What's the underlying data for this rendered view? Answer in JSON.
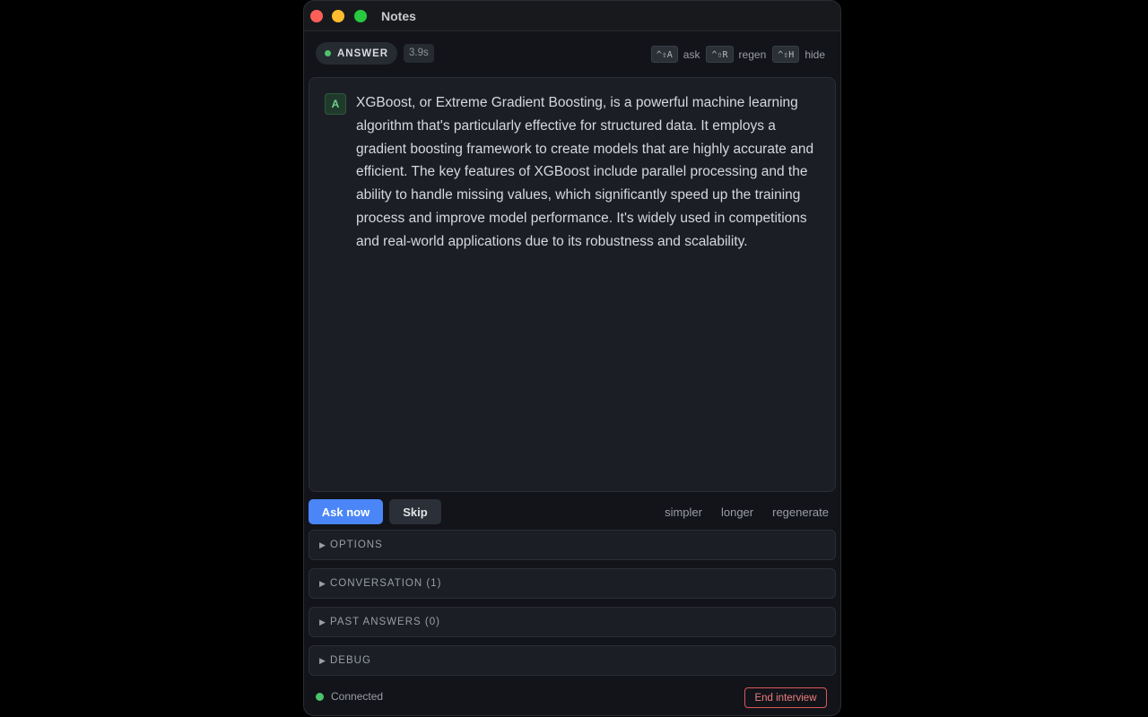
{
  "window": {
    "title": "Notes"
  },
  "toolbar": {
    "mode_label": "ANSWER",
    "elapsed": "3.9s",
    "shortcuts": [
      {
        "keys": "^⇧A",
        "label": "ask"
      },
      {
        "keys": "^⇧R",
        "label": "regen"
      },
      {
        "keys": "^⇧H",
        "label": "hide"
      }
    ]
  },
  "answer": {
    "avatar_letter": "A",
    "text": "XGBoost, or Extreme Gradient Boosting, is a powerful machine learning algorithm that's particularly effective for structured data. It employs a gradient boosting framework to create models that are highly accurate and efficient. The key features of XGBoost include parallel processing and the ability to handle missing values, which significantly speed up the training process and improve model performance. It's widely used in competitions and real-world applications due to its robustness and scalability."
  },
  "actions": {
    "ask_now": "Ask now",
    "skip": "Skip",
    "simpler": "simpler",
    "longer": "longer",
    "regenerate": "regenerate"
  },
  "sections": [
    {
      "label": "OPTIONS"
    },
    {
      "label": "CONVERSATION (1)"
    },
    {
      "label": "PAST ANSWERS (0)"
    },
    {
      "label": "DEBUG"
    }
  ],
  "footer": {
    "status": "Connected",
    "end_button": "End interview"
  },
  "colors": {
    "accent": "#4a86f7",
    "connected": "#4cc36b",
    "danger": "#d9575a"
  }
}
